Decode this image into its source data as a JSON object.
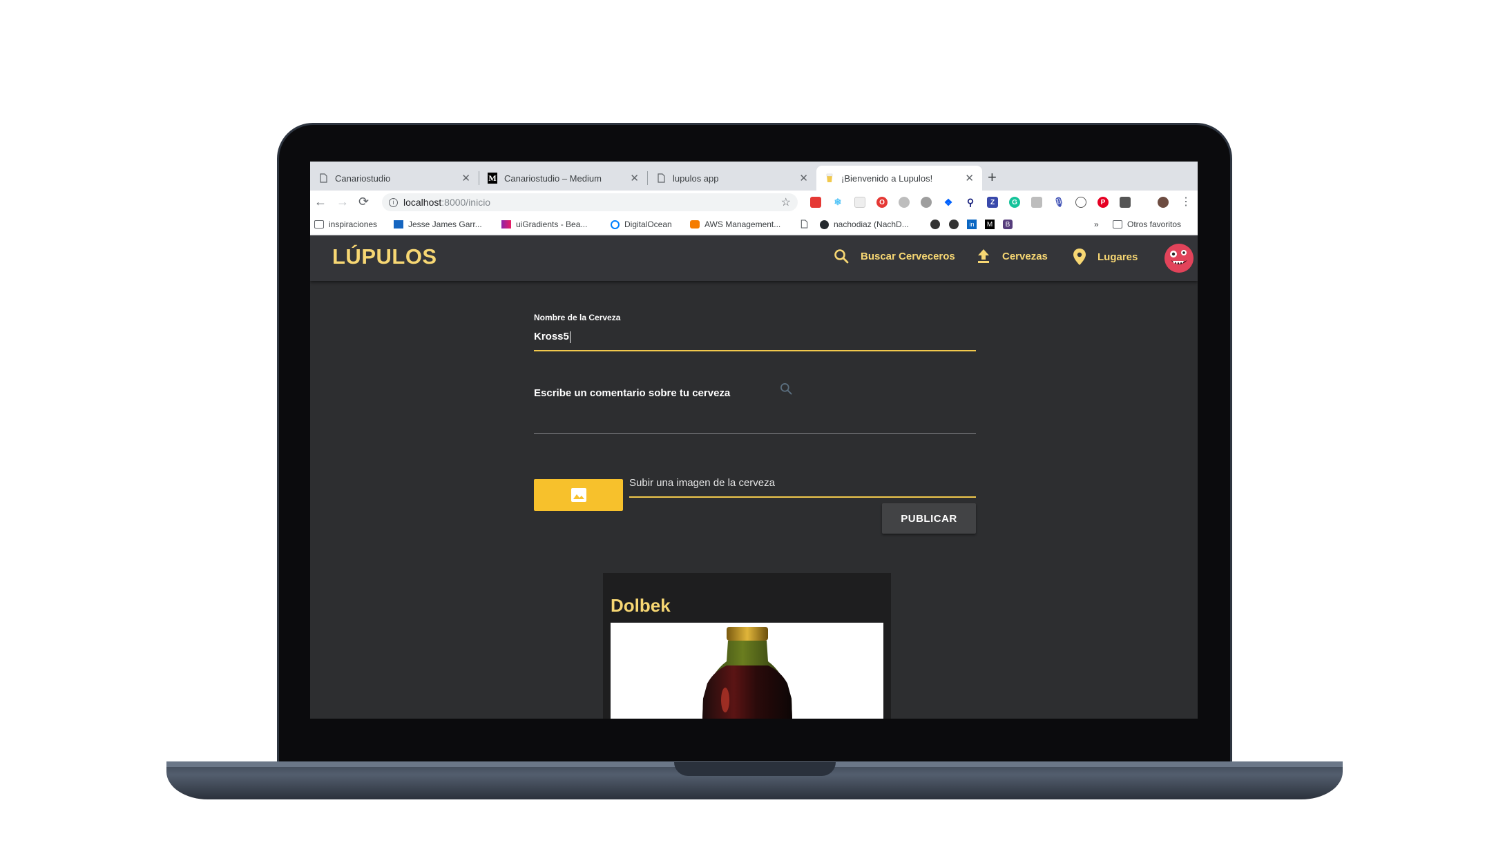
{
  "browser": {
    "tabs": [
      {
        "title": "Canariostudio",
        "icon": "page-icon"
      },
      {
        "title": "Canariostudio – Medium",
        "icon": "medium-icon"
      },
      {
        "title": "lupulos app",
        "icon": "page-icon"
      },
      {
        "title": "¡Bienvenido a Lupulos!",
        "icon": "beer-icon",
        "active": true
      }
    ],
    "url_host": "localhost",
    "url_path": ":8000/inicio",
    "bookmarks": [
      {
        "label": "inspiraciones",
        "icon": "folder-icon"
      },
      {
        "label": "Jesse James Garr...",
        "icon": "site-icon"
      },
      {
        "label": "uiGradients - Bea...",
        "icon": "site-icon"
      },
      {
        "label": "DigitalOcean",
        "icon": "digitalocean-icon"
      },
      {
        "label": "AWS Management...",
        "icon": "aws-icon"
      },
      {
        "label": "nachodiaz (NachD...",
        "icon": "github-icon"
      },
      {
        "label": "»",
        "icon": ""
      },
      {
        "label": "Otros favoritos",
        "icon": "folder-icon"
      }
    ]
  },
  "app": {
    "logo": "LÚPULOS",
    "nav": {
      "search_label": "Buscar Cerveceros",
      "beers_label": "Cervezas",
      "places_label": "Lugares"
    },
    "form": {
      "name_label": "Nombre de la Cerveza",
      "name_value": "Kross5",
      "comment_placeholder": "Escribe un comentario sobre tu cerveza",
      "upload_label": "Subir una imagen de la cerveza",
      "publish_label": "PUBLICAR"
    },
    "card": {
      "title": "Dolbek"
    },
    "colors": {
      "accent": "#f7d773",
      "button_yellow": "#f7c12c",
      "background": "#2d2e30",
      "appbar": "#343539"
    }
  }
}
